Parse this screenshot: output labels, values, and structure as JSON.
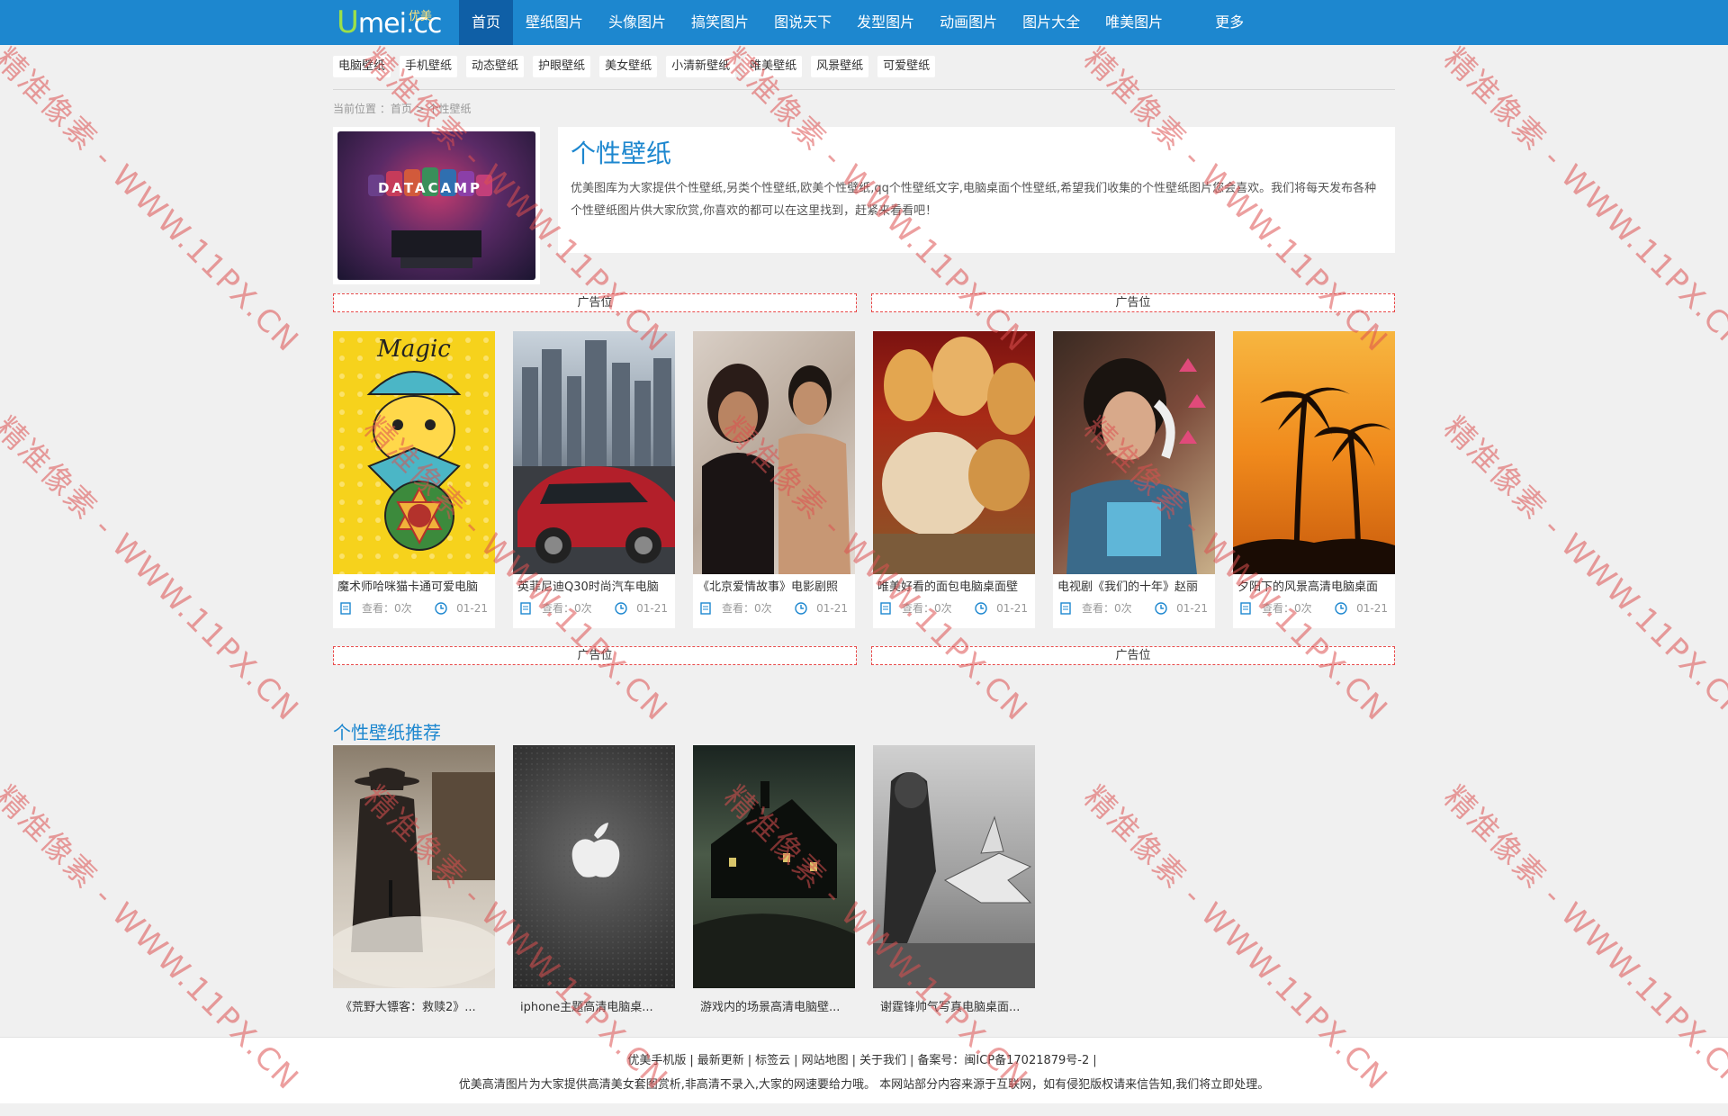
{
  "logo": {
    "main_u": "U",
    "main_rest": "mei.cc",
    "sub": "优美"
  },
  "nav": [
    {
      "label": "首页",
      "active": true
    },
    {
      "label": "壁纸图片"
    },
    {
      "label": "头像图片"
    },
    {
      "label": "搞笑图片"
    },
    {
      "label": "图说天下"
    },
    {
      "label": "发型图片"
    },
    {
      "label": "动画图片"
    },
    {
      "label": "图片大全"
    },
    {
      "label": "唯美图片"
    },
    {
      "label": "更多"
    }
  ],
  "subnav": [
    "电脑壁纸",
    "手机壁纸",
    "动态壁纸",
    "护眼壁纸",
    "美女壁纸",
    "小清新壁纸",
    "唯美壁纸",
    "风景壁纸",
    "可爱壁纸"
  ],
  "breadcrumb": {
    "prefix": "当前位置 ：",
    "home": "首页",
    "sep": " > ",
    "current": "个性壁纸"
  },
  "intro": {
    "thumb_text": "DATACAMP",
    "title": "个性壁纸",
    "desc": "优美图库为大家提供个性壁纸,另类个性壁纸,欧美个性壁纸,qq个性壁纸文字,电脑桌面个性壁纸,希望我们收集的个性壁纸图片您会喜欢。我们将每天发布各种个性壁纸图片供大家欣赏,你喜欢的都可以在这里找到，赶紧来看看吧！"
  },
  "ads": [
    "广告位",
    "广告位",
    "广告位",
    "广告位"
  ],
  "cards": [
    {
      "title": "魔术师哈咪猫卡通可爱电脑",
      "views": "查看：0次",
      "date": "01-21"
    },
    {
      "title": "英菲尼迪Q30时尚汽车电脑",
      "views": "查看：0次",
      "date": "01-21"
    },
    {
      "title": "《北京爱情故事》电影剧照",
      "views": "查看：0次",
      "date": "01-21"
    },
    {
      "title": "唯美好看的面包电脑桌面壁",
      "views": "查看：0次",
      "date": "01-21"
    },
    {
      "title": "电视剧《我们的十年》赵丽",
      "views": "查看：0次",
      "date": "01-21"
    },
    {
      "title": "夕阳下的风景高清电脑桌面",
      "views": "查看：0次",
      "date": "01-21"
    }
  ],
  "recommend": {
    "title": "个性壁纸推荐",
    "items": [
      {
        "title": "《荒野大镖客：救赎2》..."
      },
      {
        "title": "iphone主题高清电脑桌..."
      },
      {
        "title": "游戏内的场景高清电脑壁..."
      },
      {
        "title": "谢霆锋帅气写真电脑桌面..."
      }
    ]
  },
  "footer": {
    "links": [
      "优美手机版",
      "最新更新",
      "标签云",
      "网站地图",
      "关于我们",
      "备案号：闽ICP备17021879号-2"
    ],
    "note": "优美高清图片为大家提供高清美女套图赏析,非高清不录入,大家的网速要给力哦。  本网站部分内容来源于互联网，如有侵犯版权请来信告知,我们将立即处理。"
  },
  "watermark": "精准像素 - WWW.11PX.CN",
  "colors": {
    "brand": "#1d87cf",
    "nav_active": "#0f5fa6",
    "ad_border": "#e84b4b"
  }
}
